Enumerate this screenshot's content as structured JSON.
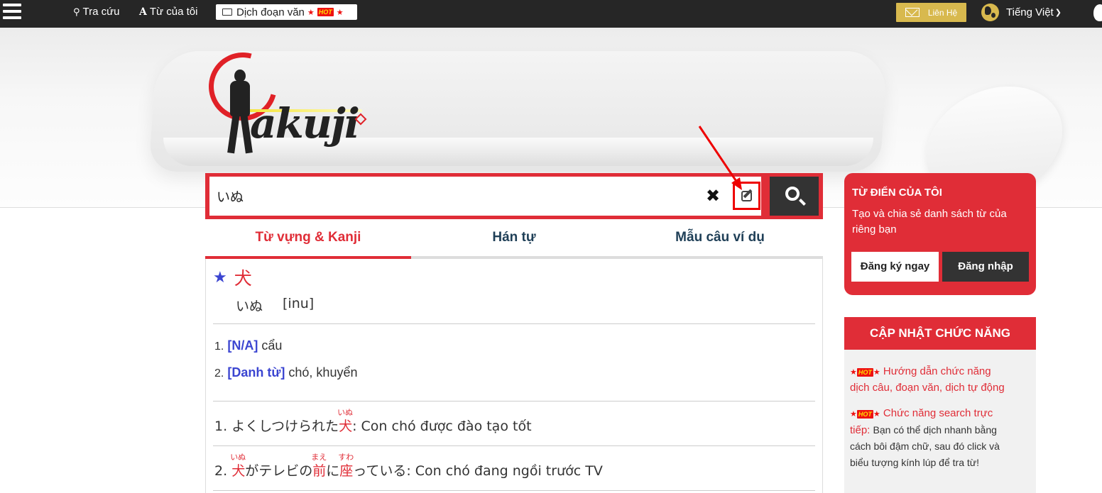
{
  "topbar": {
    "menu_icon": "hamburger-icon",
    "tra_cuu": "Tra cứu",
    "tu_cua_toi": "Từ của tôi",
    "dich_doan_van": "Dịch đoạn văn",
    "hot_badge": "HOT",
    "lien_he": "Liên Hệ",
    "language": "Tiếng Việt"
  },
  "logo": {
    "text": "akuji"
  },
  "search": {
    "value": "いぬ",
    "clear": "✖"
  },
  "tabs": [
    {
      "label": "Từ vựng & Kanji"
    },
    {
      "label": "Hán tự"
    },
    {
      "label": "Mẫu câu ví dụ"
    }
  ],
  "result": {
    "kanji": "犬",
    "reading_kana": "いぬ",
    "reading_romaji": "[inu]",
    "meanings": [
      {
        "num": "1.",
        "tag": "[N/A]",
        "text": "cẩu"
      },
      {
        "num": "2.",
        "tag": "[Danh từ]",
        "text": "chó, khuyển"
      }
    ],
    "examples": [
      {
        "num": "1.",
        "ja_pre": "よくしつけられた",
        "k1": "犬",
        "r1": "いぬ",
        "sep": ":",
        "vi": "Con chó được đào tạo tốt"
      },
      {
        "num": "2.",
        "k1": "犬",
        "r1": "いぬ",
        "mid1": "がテレビの",
        "k2": "前",
        "r2": "まえ",
        "mid2": "に",
        "k3": "座",
        "r3": "すわ",
        "post": "っている",
        "sep": ":",
        "vi": "Con chó đang ngồi trước TV"
      }
    ]
  },
  "sidebar": {
    "mydict_title": "TỪ ĐIỂN CỦA TÔI",
    "mydict_desc": "Tạo và chia sẻ danh sách từ của riêng bạn",
    "signup": "Đăng ký ngay",
    "login": "Đăng nhập",
    "updates_title": "CẬP NHẬT CHỨC NĂNG",
    "update1": "Hướng dẫn chức năng dịch câu, đoạn văn, dịch tự động",
    "update2_link": "Chức năng search trực tiếp:",
    "update2_text": "Bạn có thể dịch nhanh bằng cách bôi đậm chữ, sau đó click và biểu tượng kính lúp để tra từ!"
  },
  "colors": {
    "brand_red": "#e02d37",
    "topbar": "#262626",
    "accent_gold": "#d8b94e",
    "tag_blue": "#3b45d1"
  }
}
